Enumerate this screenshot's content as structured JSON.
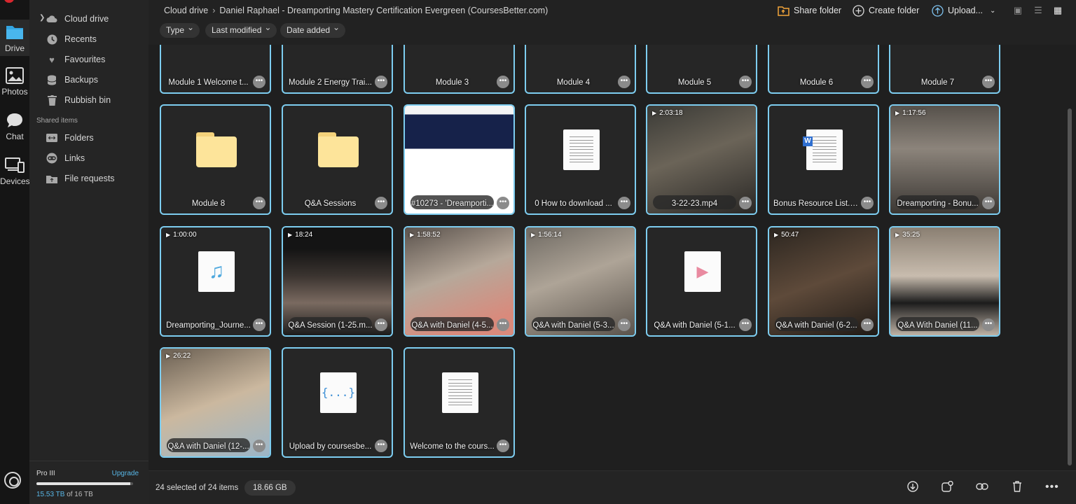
{
  "rail": {
    "items": [
      {
        "label": "Drive",
        "icon": "cloud-drive-icon"
      },
      {
        "label": "Photos",
        "icon": "photos-icon"
      },
      {
        "label": "Chat",
        "icon": "chat-icon"
      },
      {
        "label": "Devices",
        "icon": "devices-icon"
      }
    ]
  },
  "sidebar": {
    "items": [
      {
        "label": "Cloud drive",
        "icon": "cloud-icon"
      },
      {
        "label": "Recents",
        "icon": "clock-icon"
      },
      {
        "label": "Favourites",
        "icon": "heart-icon"
      },
      {
        "label": "Backups",
        "icon": "database-icon"
      },
      {
        "label": "Rubbish bin",
        "icon": "trash-icon"
      }
    ],
    "shared_label": "Shared items",
    "shared_items": [
      {
        "label": "Folders",
        "icon": "shared-folder-icon"
      },
      {
        "label": "Links",
        "icon": "link-icon"
      },
      {
        "label": "File requests",
        "icon": "file-request-icon"
      }
    ],
    "storage": {
      "plan": "Pro III",
      "upgrade": "Upgrade",
      "used": "15.53 TB",
      "of": "of 16 TB",
      "used_fraction": 0.97
    }
  },
  "header": {
    "breadcrumb": [
      "Cloud drive",
      "Daniel Raphael - Dreamporting Mastery Certification Evergreen (CoursesBetter.com)"
    ],
    "filters": [
      "Type",
      "Last modified",
      "Date added"
    ],
    "actions": {
      "share": "Share folder",
      "create": "Create folder",
      "upload": "Upload..."
    }
  },
  "files": [
    {
      "name": "Module 1 Welcome t...",
      "kind": "folder"
    },
    {
      "name": "Module 2 Energy Trai...",
      "kind": "folder"
    },
    {
      "name": "Module 3",
      "kind": "folder"
    },
    {
      "name": "Module 4",
      "kind": "folder"
    },
    {
      "name": "Module 5",
      "kind": "folder"
    },
    {
      "name": "Module 6",
      "kind": "folder"
    },
    {
      "name": "Module 7",
      "kind": "folder"
    },
    {
      "name": "Module 8",
      "kind": "folder"
    },
    {
      "name": "Q&A Sessions",
      "kind": "folder"
    },
    {
      "name": "#10273 - 'Dreamporti...",
      "kind": "webpage"
    },
    {
      "name": "0 How to download ...",
      "kind": "doc"
    },
    {
      "name": "3-22-23.mp4",
      "kind": "video",
      "duration": "2:03:18"
    },
    {
      "name": "Bonus Resource List.d...",
      "kind": "word"
    },
    {
      "name": "Dreamporting - Bonu...",
      "kind": "video",
      "duration": "1:17:56"
    },
    {
      "name": "Dreamporting_Journe...",
      "kind": "audio",
      "duration": "1:00:00"
    },
    {
      "name": "Q&A Session (1-25.m...",
      "kind": "video",
      "duration": "18:24"
    },
    {
      "name": "Q&A with Daniel (4-5...",
      "kind": "video",
      "duration": "1:58:52"
    },
    {
      "name": "Q&A with Daniel (5-3...",
      "kind": "video",
      "duration": "1:56:14"
    },
    {
      "name": "Q&A with Daniel (5-1...",
      "kind": "videofile"
    },
    {
      "name": "Q&A with Daniel (6-2...",
      "kind": "video",
      "duration": "50:47"
    },
    {
      "name": "Q&A With Daniel (11...",
      "kind": "video",
      "duration": "35:25"
    },
    {
      "name": "Q&A with Daniel (12-...",
      "kind": "video",
      "duration": "26:22"
    },
    {
      "name": "Upload by coursesbe...",
      "kind": "code"
    },
    {
      "name": "Welcome to the cours...",
      "kind": "doc"
    }
  ],
  "footer": {
    "selection": "24 selected of 24 items",
    "size": "18.66 GB"
  }
}
